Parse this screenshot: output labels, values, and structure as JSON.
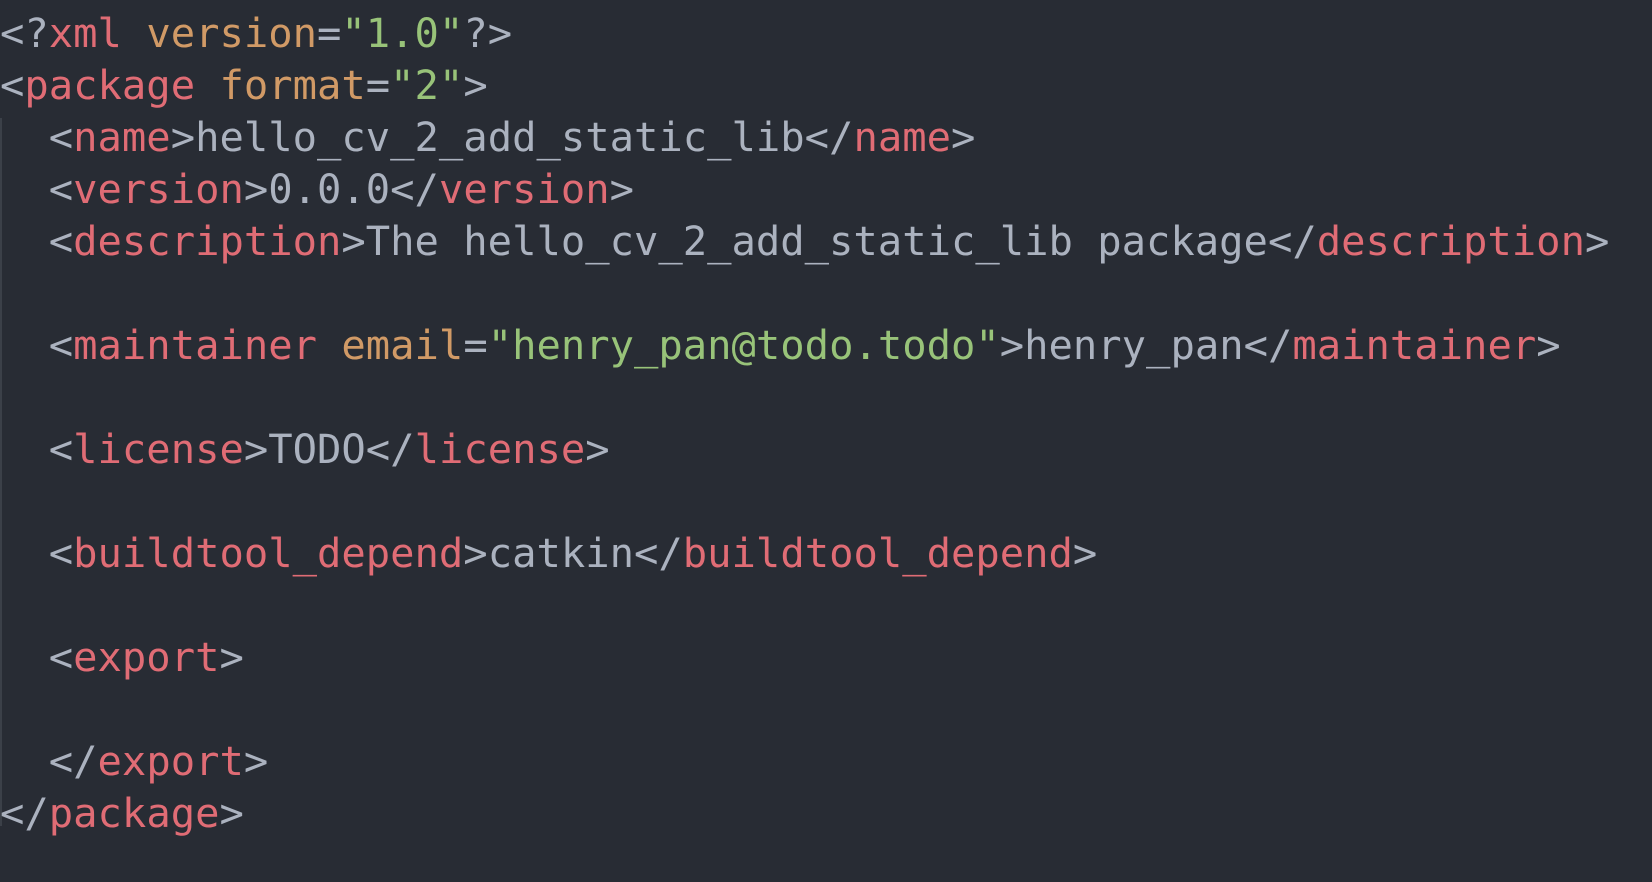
{
  "editor": {
    "language": "xml",
    "colors": {
      "background": "#282c34",
      "punctuation": "#abb2bf",
      "tag": "#e06c75",
      "attribute": "#d19a66",
      "string": "#98c379",
      "text": "#abb2bf",
      "indent_guide": "#3b4048"
    },
    "lines": [
      {
        "segments": [
          {
            "t": "p",
            "v": "<?"
          },
          {
            "t": "tag",
            "v": "xml"
          },
          {
            "t": "p",
            "v": " "
          },
          {
            "t": "attr",
            "v": "version"
          },
          {
            "t": "p",
            "v": "="
          },
          {
            "t": "str",
            "v": "\"1.0\""
          },
          {
            "t": "p",
            "v": "?>"
          }
        ]
      },
      {
        "segments": [
          {
            "t": "p",
            "v": "<"
          },
          {
            "t": "tag",
            "v": "package"
          },
          {
            "t": "p",
            "v": " "
          },
          {
            "t": "attr",
            "v": "format"
          },
          {
            "t": "p",
            "v": "="
          },
          {
            "t": "str",
            "v": "\"2\""
          },
          {
            "t": "p",
            "v": ">"
          }
        ]
      },
      {
        "segments": [
          {
            "t": "p",
            "v": "  <"
          },
          {
            "t": "tag",
            "v": "name"
          },
          {
            "t": "p",
            "v": ">"
          },
          {
            "t": "txt",
            "v": "hello_cv_2_add_static_lib"
          },
          {
            "t": "p",
            "v": "</"
          },
          {
            "t": "tag",
            "v": "name"
          },
          {
            "t": "p",
            "v": ">"
          }
        ]
      },
      {
        "segments": [
          {
            "t": "p",
            "v": "  <"
          },
          {
            "t": "tag",
            "v": "version"
          },
          {
            "t": "p",
            "v": ">"
          },
          {
            "t": "txt",
            "v": "0.0.0"
          },
          {
            "t": "p",
            "v": "</"
          },
          {
            "t": "tag",
            "v": "version"
          },
          {
            "t": "p",
            "v": ">"
          }
        ]
      },
      {
        "segments": [
          {
            "t": "p",
            "v": "  <"
          },
          {
            "t": "tag",
            "v": "description"
          },
          {
            "t": "p",
            "v": ">"
          },
          {
            "t": "txt",
            "v": "The hello_cv_2_add_static_lib package"
          },
          {
            "t": "p",
            "v": "</"
          },
          {
            "t": "tag",
            "v": "description"
          },
          {
            "t": "p",
            "v": ">"
          }
        ]
      },
      {
        "segments": []
      },
      {
        "segments": [
          {
            "t": "p",
            "v": "  <"
          },
          {
            "t": "tag",
            "v": "maintainer"
          },
          {
            "t": "p",
            "v": " "
          },
          {
            "t": "attr",
            "v": "email"
          },
          {
            "t": "p",
            "v": "="
          },
          {
            "t": "str",
            "v": "\"henry_pan@todo.todo\""
          },
          {
            "t": "p",
            "v": ">"
          },
          {
            "t": "txt",
            "v": "henry_pan"
          },
          {
            "t": "p",
            "v": "</"
          },
          {
            "t": "tag",
            "v": "maintainer"
          },
          {
            "t": "p",
            "v": ">"
          }
        ]
      },
      {
        "segments": []
      },
      {
        "segments": [
          {
            "t": "p",
            "v": "  <"
          },
          {
            "t": "tag",
            "v": "license"
          },
          {
            "t": "p",
            "v": ">"
          },
          {
            "t": "txt",
            "v": "TODO"
          },
          {
            "t": "p",
            "v": "</"
          },
          {
            "t": "tag",
            "v": "license"
          },
          {
            "t": "p",
            "v": ">"
          }
        ]
      },
      {
        "segments": []
      },
      {
        "segments": [
          {
            "t": "p",
            "v": "  <"
          },
          {
            "t": "tag",
            "v": "buildtool_depend"
          },
          {
            "t": "p",
            "v": ">"
          },
          {
            "t": "txt",
            "v": "catkin"
          },
          {
            "t": "p",
            "v": "</"
          },
          {
            "t": "tag",
            "v": "buildtool_depend"
          },
          {
            "t": "p",
            "v": ">"
          }
        ]
      },
      {
        "segments": []
      },
      {
        "segments": [
          {
            "t": "p",
            "v": "  <"
          },
          {
            "t": "tag",
            "v": "export"
          },
          {
            "t": "p",
            "v": ">"
          }
        ]
      },
      {
        "segments": []
      },
      {
        "segments": [
          {
            "t": "p",
            "v": "  </"
          },
          {
            "t": "tag",
            "v": "export"
          },
          {
            "t": "p",
            "v": ">"
          }
        ]
      },
      {
        "segments": [
          {
            "t": "p",
            "v": "</"
          },
          {
            "t": "tag",
            "v": "package"
          },
          {
            "t": "p",
            "v": ">"
          }
        ]
      }
    ]
  }
}
